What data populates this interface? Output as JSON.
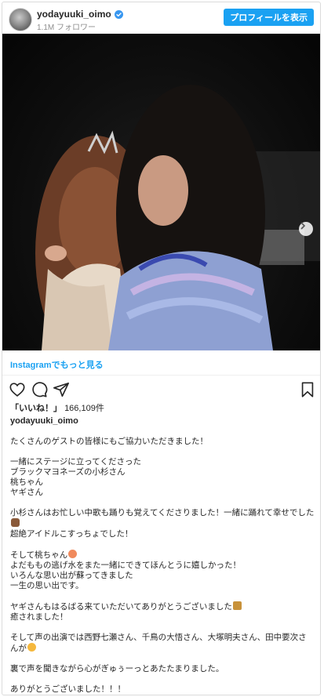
{
  "header": {
    "username": "yodayuuki_oimo",
    "followers": "1.1M フォロワー",
    "profile_button": "プロフィールを表示"
  },
  "icons": {
    "verified": "verified-badge-icon",
    "next": "chevron-right-icon",
    "like": "heart-icon",
    "comment": "comment-icon",
    "share": "share-icon",
    "save": "bookmark-icon"
  },
  "colors": {
    "accent": "#1aa1f2",
    "text": "#262626",
    "muted": "#8e8e8e"
  },
  "more_link": "Instagramでもっと見る",
  "likes": {
    "label": "「いいね！」",
    "count": "166,109件"
  },
  "owner": "yodayuuki_oimo",
  "caption": {
    "line1": "たくさんのゲストの皆様にもご協力いただきました！",
    "line2": "一緒にステージに立ってくださった",
    "line3": "ブラックマヨネーズの小杉さん",
    "line4": "桃ちゃん",
    "line5": "ヤギさん",
    "line6": "小杉さんはお忙しい中歌も踊りも覚えてくださりました！一緒に踊れて幸せでした",
    "line7": "超絶アイドルこすっちょでした！",
    "line8": "そして桃ちゃん",
    "line9": "よだももの逃げ水をまた一緒にできてほんとうに嬉しかった！",
    "line10": "いろんな思い出が蘇ってきました",
    "line11": "一生の思い出です。",
    "line12": "ヤギさんもはるばる来ていただいてありがとうございました",
    "line13": "癒されました！",
    "line14": "そして声の出演では西野七瀬さん、千鳥の大悟さん、大塚明夫さん、田中要次さんが",
    "line15": "裏で声を聞きながら心がぎゅぅーっとあたたまりました。",
    "line16": "ありがとうございました！！！"
  }
}
